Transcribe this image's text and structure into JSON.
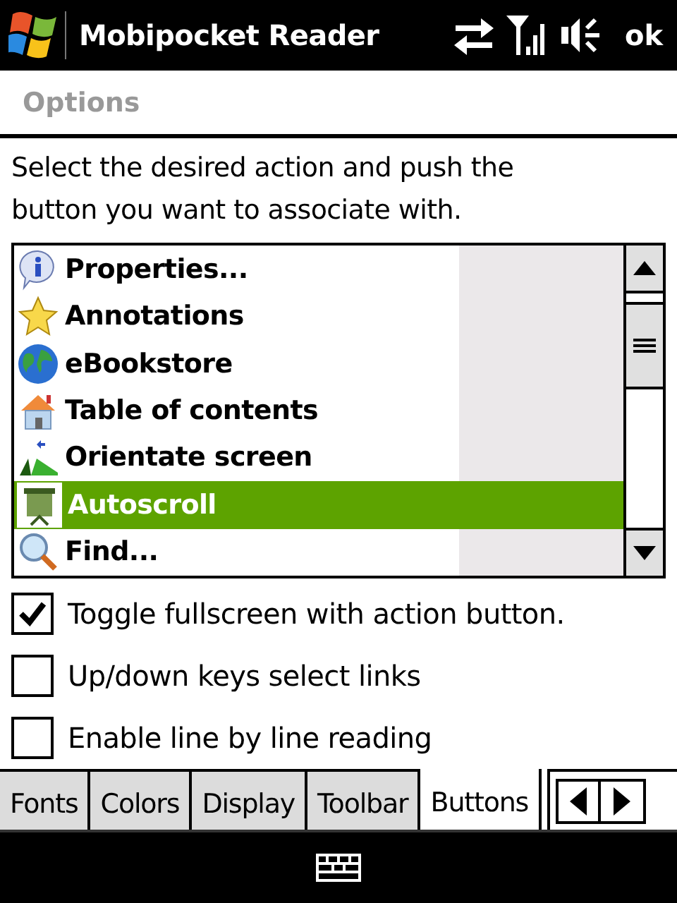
{
  "title_bar": {
    "title": "Mobipocket Reader",
    "ok": "ok"
  },
  "header": {
    "title": "Options"
  },
  "instruction": "Select the desired action and push the button you want to associate with.",
  "actions": [
    {
      "label": "Properties...",
      "selected": false
    },
    {
      "label": "Annotations",
      "selected": false
    },
    {
      "label": "eBookstore",
      "selected": false
    },
    {
      "label": "Table of contents",
      "selected": false
    },
    {
      "label": "Orientate screen",
      "selected": false
    },
    {
      "label": "Autoscroll",
      "selected": true
    },
    {
      "label": "Find...",
      "selected": false
    }
  ],
  "options": [
    {
      "label": "Toggle fullscreen with action button.",
      "checked": true
    },
    {
      "label": "Up/down keys select links",
      "checked": false
    },
    {
      "label": "Enable line by line reading",
      "checked": false
    }
  ],
  "tabs": [
    {
      "label": "Fonts",
      "selected": false
    },
    {
      "label": "Colors",
      "selected": false
    },
    {
      "label": "Display",
      "selected": false
    },
    {
      "label": "Toolbar",
      "selected": false
    },
    {
      "label": "Buttons",
      "selected": true
    }
  ]
}
